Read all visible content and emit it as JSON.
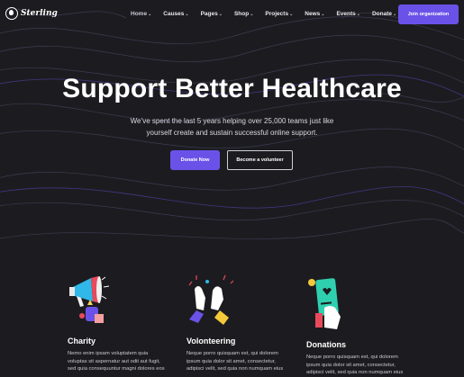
{
  "brand": {
    "name": "Sterling"
  },
  "nav": {
    "items": [
      {
        "label": "Home"
      },
      {
        "label": "Causes"
      },
      {
        "label": "Pages"
      },
      {
        "label": "Shop"
      },
      {
        "label": "Projects"
      },
      {
        "label": "News"
      },
      {
        "label": "Events"
      },
      {
        "label": "Donate"
      }
    ],
    "cta": "Join organization"
  },
  "hero": {
    "title": "Support Better Healthcare",
    "subtitle_line1": "We’ve spent the last 5 years helping over 25,000 teams just like",
    "subtitle_line2": "yourself create and sustain successful online support.",
    "primary_button": "Donate Now",
    "secondary_button": "Become a volunteer"
  },
  "features": [
    {
      "icon": "megaphone-icon",
      "title": "Charity",
      "text_lines": [
        "Nemo enim ipsam voluptatem quia",
        "voluptas sit aspernatur aut odit aut fugit,",
        "sed quia consequuntur magni dolores eos"
      ]
    },
    {
      "icon": "high-five-icon",
      "title": "Volonteering",
      "text_lines": [
        "Neque porro quisquam est, qui dolorem",
        "ipsum quia dolor sit amet, consectetur,",
        "adipisci velit, sed quia non numquam eius"
      ]
    },
    {
      "icon": "phone-donation-icon",
      "title": "Donations",
      "text_lines": [
        "Neque porro quisquam est, qui dolorem",
        "ipsum quia dolor sit amet, consectetur,",
        "adipisci velit, sed quia non numquam eius"
      ]
    }
  ],
  "colors": {
    "accent": "#6a52e8",
    "background": "#1c1c20"
  }
}
